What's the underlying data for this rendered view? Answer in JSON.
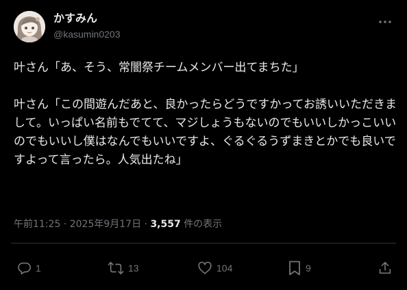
{
  "author": {
    "display_name": "かすみん",
    "handle": "@kasumin0203"
  },
  "post": {
    "text": "叶さん「あ、そう、常闇祭チームメンバー出てまちた」\n\n叶さん「この間遊んだあと、良かったらどうですかってお誘いいただきまして。いっぱい名前もでてて、マジしょうもないのでもいいしかっこいいのでもいいし僕はなんでもいいですよ、ぐるぐるうずまきとかでも良いですよって言ったら。人気出たね」",
    "time": "午前11:25",
    "separator": "·",
    "date": "2025年9月17日",
    "views_count": "3,557",
    "views_label": "件の表示"
  },
  "actions": {
    "reply_count": "1",
    "repost_count": "13",
    "like_count": "104",
    "bookmark_count": "9"
  },
  "icons": {
    "more": "more-dots-icon",
    "reply": "reply-bubble-icon",
    "repost": "repost-arrows-icon",
    "like": "heart-icon",
    "bookmark": "bookmark-icon",
    "share": "share-upload-icon"
  },
  "colors": {
    "background": "#000000",
    "text": "#e7e9ea",
    "muted": "#71767b",
    "divider": "#2f3336"
  }
}
